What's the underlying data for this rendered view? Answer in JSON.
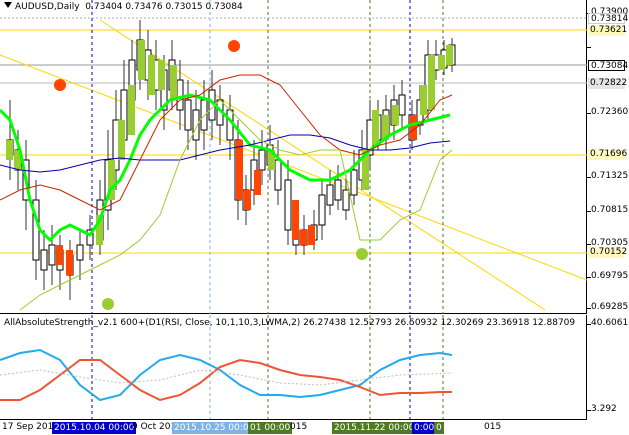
{
  "main": {
    "symbol": "AUDUSD,Daily",
    "ohlc": "0.73404 0.73476 0.73015 0.73084",
    "price_labels": [
      "0.73900",
      "0.73814",
      "0.73621",
      "0.73084",
      "0.72822",
      "0.72360",
      "0.71696",
      "0.71325",
      "0.70815",
      "0.70305",
      "0.70152",
      "0.69795",
      "0.69285"
    ],
    "current_price": "0.73084"
  },
  "sub": {
    "title": "AllAbsoluteStrength_v2.1 600+(D1(RSI, Close, 10,1,10,3,LWMA,2) 26.27438 12.52793 26.50932 12.30269 23.36918 12.88709",
    "max_label": "40.60615",
    "min_label": "3.292"
  },
  "date_axis": {
    "labels": [
      "17 Sep 2015",
      "9 Oct 2015",
      "00 2015",
      "0 2015",
      "015"
    ],
    "chips": [
      {
        "text": "2015.10.04 00:00",
        "color": "#0000cc"
      },
      {
        "text": "2015.10.25 00:00",
        "color": "#7fb2e5"
      },
      {
        "text": "2015.11.22 00:00",
        "color": "#4d7a23"
      },
      {
        "text": "01 00:00",
        "color": "#4d7a23"
      },
      {
        "text": "0:00",
        "color": "#0000cc"
      },
      {
        "text": "0",
        "color": "#4d7a23"
      }
    ]
  },
  "colors": {
    "bull": "#9acd32",
    "bear": "#ff4500",
    "signal": "#00ff00",
    "blue_line": "#0000aa",
    "red_line": "#cc2200",
    "strength_blue": "#22aaee",
    "strength_red": "#ee5533",
    "fib_yellow": "#ffd700"
  }
}
